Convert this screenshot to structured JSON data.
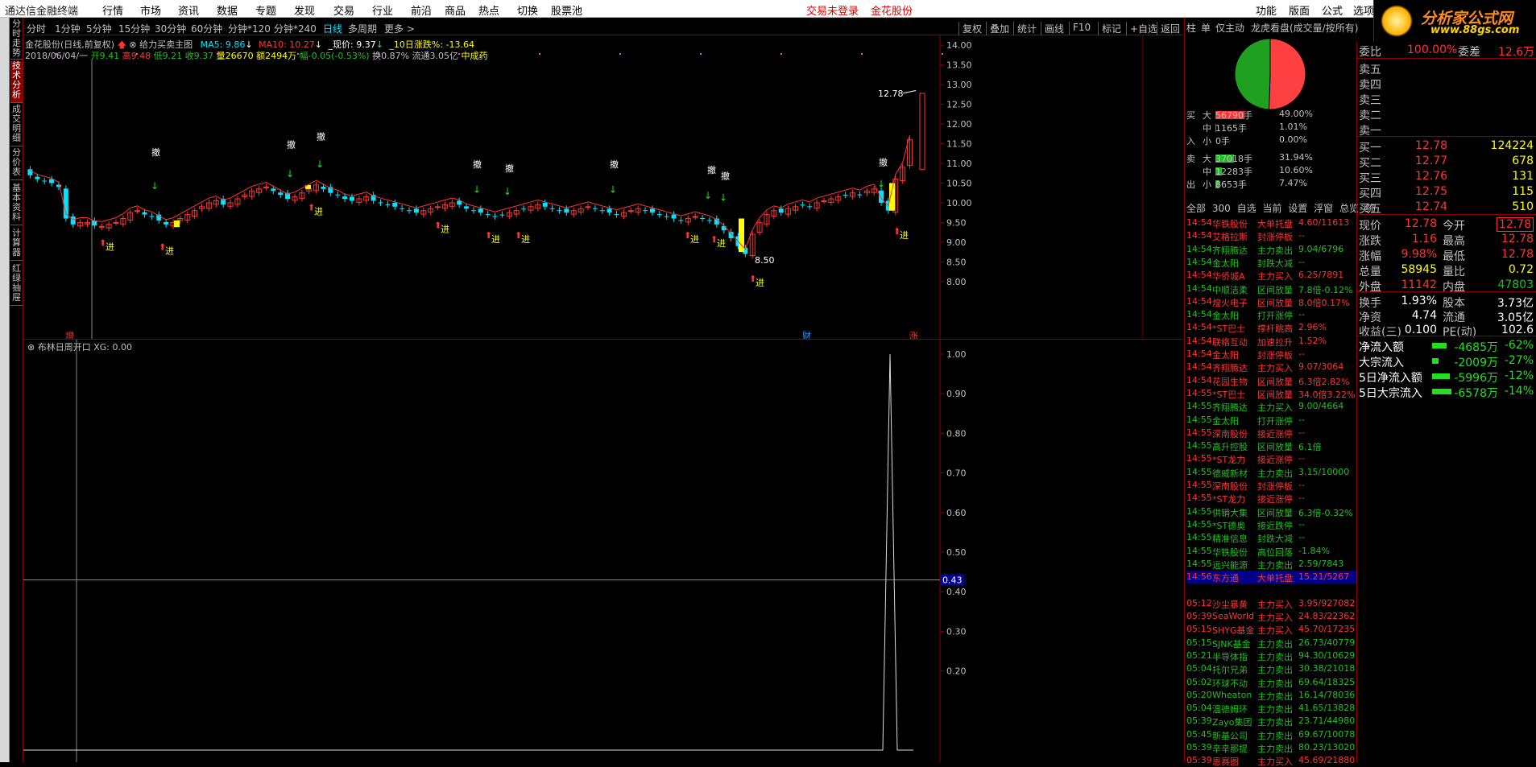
{
  "menubar": {
    "app_title": "通达信金融终端",
    "items": [
      "行情",
      "市场",
      "资讯",
      "数据",
      "专题",
      "发现",
      "交易",
      "行业",
      "前沿",
      "商品",
      "热点",
      "切换",
      "股票池"
    ],
    "login": "交易未登录",
    "stock": "金花股份",
    "right_items": [
      "功能",
      "版面",
      "公式",
      "选项",
      "帮助"
    ]
  },
  "logo": {
    "line1": "分析家公式网",
    "line2": "www.88gs.com"
  },
  "left_tabs": [
    {
      "label": "分时走势",
      "active": false
    },
    {
      "label": "技术分析",
      "active": true
    },
    {
      "label": "成交明细",
      "active": false
    },
    {
      "label": "分价表",
      "active": false
    },
    {
      "label": "基本资料",
      "active": false
    },
    {
      "label": "计算器",
      "active": false
    },
    {
      "label": "红绿抽屉",
      "active": false
    }
  ],
  "periods": [
    {
      "label": "分时",
      "selected": false
    },
    {
      "label": "1分钟",
      "selected": false
    },
    {
      "label": "5分钟",
      "selected": false
    },
    {
      "label": "15分钟",
      "selected": false
    },
    {
      "label": "30分钟",
      "selected": false
    },
    {
      "label": "60分钟",
      "selected": false
    },
    {
      "label": "分钟*120",
      "selected": false
    },
    {
      "label": "分钟*240",
      "selected": false
    },
    {
      "label": "日线",
      "selected": true
    },
    {
      "label": "多周期",
      "selected": false
    },
    {
      "label": "更多 >",
      "selected": false
    }
  ],
  "tools": [
    "复权",
    "叠加",
    "统计",
    "画线",
    "F10",
    "标记",
    "+自选",
    "返回"
  ],
  "kline_info": {
    "name": "金花股份(日线,前复权)",
    "formula": "给力买卖主图",
    "ma5": "MA5: 9.86",
    "ma10": "MA10: 10.27",
    "now": "_现价: 9.37",
    "chg10": "_10日涨跌%: -13.64",
    "date": "2018/06/04/一",
    "open": "开9.41",
    "high": "高9.48",
    "low": "低9.21",
    "close": "收9.37",
    "vol": "量26670",
    "amount": "额2494万",
    "change": "幅-0.05(-0.53%)",
    "turnover": "换0.87%",
    "float": "流通3.05亿",
    "industry": "中成药"
  },
  "kchart": {
    "y_ticks": [
      "14.00",
      "13.50",
      "13.00",
      "12.50",
      "12.00",
      "11.50",
      "11.00",
      "10.50",
      "10.00",
      "9.50",
      "9.00",
      "8.50",
      "8.00"
    ],
    "y_min": 7.75,
    "y_max": 14.25,
    "max_label": "12.78",
    "min_label": "8.50",
    "sig_buy": "进",
    "sig_cancel": "撤",
    "bottom_marks": [
      "增",
      "财",
      "涨"
    ]
  },
  "indicator": {
    "title": "布林日周开口",
    "xg": "XG: 0.00",
    "y_ticks": [
      "1.00",
      "0.90",
      "0.80",
      "0.70",
      "0.60",
      "0.50",
      "0.40",
      "0.30",
      "0.20"
    ],
    "cursor_value": "0.43",
    "peak_value": 1.0
  },
  "right_panel": {
    "tabs": [
      "柱",
      "单",
      "仅主动",
      "龙虎看盘(成交量/按所有)"
    ],
    "pie": {
      "buy_pct": 50.55,
      "sell_pct": 49.45
    },
    "buy_side": "买",
    "buy_side2": "入",
    "sell_side": "卖",
    "sell_side2": "出",
    "flows": [
      {
        "side": "买",
        "size": "大",
        "vol": "56790手",
        "pct": "49.00%",
        "color": "#ff3333",
        "bar": 100
      },
      {
        "side": "",
        "size": "中",
        "vol": "1165手",
        "pct": "1.01%",
        "color": "#ff3333",
        "bar": 2
      },
      {
        "side": "入",
        "size": "小",
        "vol": "0手",
        "pct": "0.00%",
        "color": "#ff3333",
        "bar": 0
      },
      {
        "side": "卖",
        "size": "大",
        "vol": "37018手",
        "pct": "31.94%",
        "color": "#20c020",
        "bar": 65
      },
      {
        "side": "",
        "size": "中",
        "vol": "12283手",
        "pct": "10.60%",
        "color": "#20c020",
        "bar": 22
      },
      {
        "side": "出",
        "size": "小",
        "vol": "8653手",
        "pct": "7.47%",
        "color": "#20c020",
        "bar": 15
      }
    ],
    "tabs2": [
      "全部",
      "300",
      "自选",
      "当前",
      "设置",
      "浮窗",
      "总览",
      "统"
    ],
    "alerts": [
      {
        "t": "14:54",
        "n": "华铁股份",
        "a": "大单托盘",
        "v": "4.60/11613",
        "c": "#ff3333"
      },
      {
        "t": "14:54",
        "n": "艾格拉斯",
        "a": "封涨停板",
        "v": "--",
        "c": "#ff3333"
      },
      {
        "t": "14:54",
        "n": "齐翔腾达",
        "a": "主力卖出",
        "v": "9.04/6796",
        "c": "#20c020"
      },
      {
        "t": "14:54",
        "n": "金太阳",
        "a": "封跌大减",
        "v": "--",
        "c": "#20c020"
      },
      {
        "t": "14:54",
        "n": "华侨城A",
        "a": "主力买入",
        "v": "6.25/7891",
        "c": "#ff3333"
      },
      {
        "t": "14:54",
        "n": "中顺洁柔",
        "a": "区间放量",
        "v": "7.8倍-0.12%",
        "c": "#20c020"
      },
      {
        "t": "14:54",
        "n": "煌火电子",
        "a": "区间放量",
        "v": "8.0倍0.17%",
        "c": "#ff3333"
      },
      {
        "t": "14:54",
        "n": "金太阳",
        "a": "打开涨停",
        "v": "--",
        "c": "#20c020"
      },
      {
        "t": "14:54",
        "n": "*ST巴士",
        "a": "撑杆跳高",
        "v": "2.96%",
        "c": "#ff3333"
      },
      {
        "t": "14:54",
        "n": "联络互动",
        "a": "加速拉升",
        "v": "1.52%",
        "c": "#ff3333"
      },
      {
        "t": "14:54",
        "n": "金太阳",
        "a": "封涨停板",
        "v": "--",
        "c": "#ff3333"
      },
      {
        "t": "14:54",
        "n": "齐翔腾达",
        "a": "主力买入",
        "v": "9.07/3064",
        "c": "#ff3333"
      },
      {
        "t": "14:54",
        "n": "花园生物",
        "a": "区间放量",
        "v": "6.3倍2.82%",
        "c": "#ff3333"
      },
      {
        "t": "14:55",
        "n": "*ST巴士",
        "a": "区间放量",
        "v": "34.0倍3.22%",
        "c": "#ff3333"
      },
      {
        "t": "14:55",
        "n": "齐翔腾达",
        "a": "主力买入",
        "v": "9.00/4664",
        "c": "#20c020"
      },
      {
        "t": "14:55",
        "n": "金太阳",
        "a": "打开涨停",
        "v": "--",
        "c": "#20c020"
      },
      {
        "t": "14:55",
        "n": "深南股份",
        "a": "接近涨停",
        "v": "--",
        "c": "#ff3333"
      },
      {
        "t": "14:55",
        "n": "高升控股",
        "a": "区间放量",
        "v": "6.1倍",
        "c": "#20c020"
      },
      {
        "t": "14:55",
        "n": "*ST龙力",
        "a": "接近涨停",
        "v": "--",
        "c": "#ff3333"
      },
      {
        "t": "14:55",
        "n": "德威新材",
        "a": "主力卖出",
        "v": "3.15/10000",
        "c": "#20c020"
      },
      {
        "t": "14:55",
        "n": "深南股份",
        "a": "封涨停板",
        "v": "--",
        "c": "#ff3333"
      },
      {
        "t": "14:55",
        "n": "*ST龙力",
        "a": "接近涨停",
        "v": "--",
        "c": "#ff3333"
      },
      {
        "t": "14:55",
        "n": "供销大集",
        "a": "区间放量",
        "v": "6.3倍-0.32%",
        "c": "#20c020"
      },
      {
        "t": "14:55",
        "n": "*ST德奥",
        "a": "接近跌停",
        "v": "--",
        "c": "#20c020"
      },
      {
        "t": "14:55",
        "n": "精准信息",
        "a": "封跌大减",
        "v": "--",
        "c": "#20c020"
      },
      {
        "t": "14:55",
        "n": "华铁股份",
        "a": "高位回落",
        "v": "-1.84%",
        "c": "#20c020"
      },
      {
        "t": "14:55",
        "n": "远兴能源",
        "a": "主力卖出",
        "v": "2.59/7843",
        "c": "#20c020"
      },
      {
        "t": "14:56",
        "n": "东方通",
        "a": "大单托盘",
        "v": "15.21/5267",
        "c": "#ff3333",
        "highlight": true
      },
      {
        "t": "",
        "n": "",
        "a": "",
        "v": "",
        "c": "#ff3333"
      },
      {
        "t": "05:12",
        "n": "沙尘暴黄",
        "a": "主力买入",
        "v": "3.95/927082",
        "c": "#ff3333"
      },
      {
        "t": "05:39",
        "n": "SeaWorld",
        "a": "主力买入",
        "v": "24.83/22362",
        "c": "#ff3333"
      },
      {
        "t": "05:15",
        "n": "SHYG基金",
        "a": "主力买入",
        "v": "45.70/17235",
        "c": "#ff3333"
      },
      {
        "t": "05:15",
        "n": "SJNK基金",
        "a": "主力卖出",
        "v": "26.73/40779",
        "c": "#20c020"
      },
      {
        "t": "05:21",
        "n": "半导体指",
        "a": "主力卖出",
        "v": "94.30/10629",
        "c": "#20c020"
      },
      {
        "t": "05:04",
        "n": "托尔兄弟",
        "a": "主力卖出",
        "v": "30.38/21018",
        "c": "#20c020"
      },
      {
        "t": "05:02",
        "n": "环球不动",
        "a": "主力卖出",
        "v": "69.64/18325",
        "c": "#20c020"
      },
      {
        "t": "05:20",
        "n": "Wheaton",
        "a": "主力卖出",
        "v": "16.14/78036",
        "c": "#20c020"
      },
      {
        "t": "05:04",
        "n": "温德姆环",
        "a": "主力卖出",
        "v": "41.65/13828",
        "c": "#20c020"
      },
      {
        "t": "05:39",
        "n": "Zayo集团",
        "a": "主力卖出",
        "v": "23.71/44980",
        "c": "#20c020"
      },
      {
        "t": "05:45",
        "n": "新基公司",
        "a": "主力卖出",
        "v": "69.67/10078",
        "c": "#20c020"
      },
      {
        "t": "05:39",
        "n": "辛辛那提",
        "a": "主力卖出",
        "v": "80.23/13020",
        "c": "#20c020"
      },
      {
        "t": "05:39",
        "n": "恩赛图",
        "a": "主力买入",
        "v": "45.69/21880",
        "c": "#ff3333"
      }
    ]
  },
  "quote": {
    "weibi": {
      "l1": "委比",
      "v1": "100.00%",
      "l2": "委差",
      "v2": "12.6万"
    },
    "sells": [
      {
        "label": "卖五",
        "price": "",
        "vol": ""
      },
      {
        "label": "卖四",
        "price": "",
        "vol": ""
      },
      {
        "label": "卖三",
        "price": "",
        "vol": ""
      },
      {
        "label": "卖二",
        "price": "",
        "vol": ""
      },
      {
        "label": "卖一",
        "price": "",
        "vol": ""
      }
    ],
    "buys": [
      {
        "label": "买一",
        "price": "12.78",
        "vol": "124224"
      },
      {
        "label": "买二",
        "price": "12.77",
        "vol": "678"
      },
      {
        "label": "买三",
        "price": "12.76",
        "vol": "131"
      },
      {
        "label": "买四",
        "price": "12.75",
        "vol": "115"
      },
      {
        "label": "买五",
        "price": "12.74",
        "vol": "510"
      }
    ],
    "stats": [
      {
        "l1": "现价",
        "v1": "12.78",
        "c1": "#ff3333",
        "l2": "今开",
        "v2": "12.78",
        "c2": "#ff3333",
        "box": true
      },
      {
        "l1": "涨跌",
        "v1": "1.16",
        "c1": "#ff3333",
        "l2": "最高",
        "v2": "12.78",
        "c2": "#ff3333"
      },
      {
        "l1": "涨幅",
        "v1": "9.98%",
        "c1": "#ff3333",
        "l2": "最低",
        "v2": "12.78",
        "c2": "#ff3333"
      },
      {
        "l1": "总量",
        "v1": "58945",
        "c1": "#ffff00",
        "l2": "量比",
        "v2": "0.72",
        "c2": "#ffff00"
      },
      {
        "l1": "外盘",
        "v1": "11142",
        "c1": "#ff3333",
        "l2": "内盘",
        "v2": "47803",
        "c2": "#20c020"
      }
    ],
    "stats2": [
      {
        "l1": "换手",
        "v1": "1.93%",
        "l2": "股本",
        "v2": "3.73亿"
      },
      {
        "l1": "净资",
        "v1": "4.74",
        "l2": "流通",
        "v2": "3.05亿"
      },
      {
        "l1": "收益(三)",
        "v1": "0.100",
        "l2": "PE(动)",
        "v2": "102.6"
      }
    ],
    "fund": [
      {
        "label": "净流入额",
        "val": "-4685万",
        "pct": "-62%",
        "bar": 18
      },
      {
        "label": "大宗流入",
        "val": "-2009万",
        "pct": "-27%",
        "bar": 8
      },
      {
        "label": "5日净流入额",
        "val": "-5996万",
        "pct": "-12%",
        "bar": 22
      },
      {
        "label": "5日大宗流入",
        "val": "-6578万",
        "pct": "-14%",
        "bar": 24
      }
    ]
  }
}
